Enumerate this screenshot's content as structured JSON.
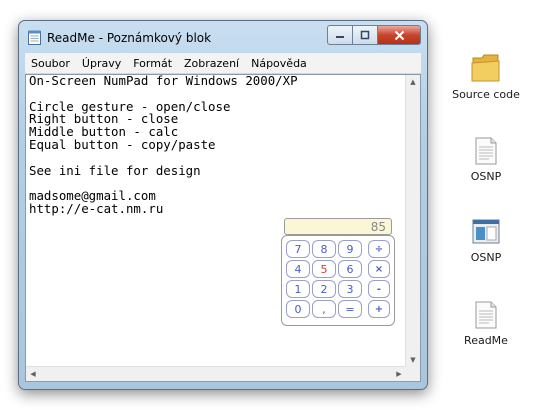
{
  "window": {
    "title": "ReadMe - Poznámkový blok"
  },
  "menu": [
    "Soubor",
    "Úpravy",
    "Formát",
    "Zobrazení",
    "Nápověda"
  ],
  "editor": {
    "lines": [
      "On-Screen NumPad for Windows 2000/XP",
      "",
      "Circle gesture - open/close",
      "Right button - close",
      "Middle button - calc",
      "Equal button - copy/paste",
      "",
      "See ini file for design",
      "",
      "madsome@gmail.com",
      "http://e-cat.nm.ru"
    ]
  },
  "numpad": {
    "display": "85",
    "rows": [
      [
        "7",
        "8",
        "9"
      ],
      [
        "4",
        "5",
        "6"
      ],
      [
        "1",
        "2",
        "3"
      ],
      [
        "0",
        ",",
        "="
      ]
    ],
    "ops": [
      "÷",
      "×",
      "-",
      "+"
    ],
    "highlight_key": "5"
  },
  "desktop": {
    "icons": [
      {
        "label": "Source code",
        "icon": "folder-icon"
      },
      {
        "label": "OSNP",
        "icon": "text-file-icon"
      },
      {
        "label": "OSNP",
        "icon": "application-icon"
      },
      {
        "label": "ReadMe",
        "icon": "text-file-icon"
      }
    ]
  },
  "colors": {
    "close_button": "#c8452d",
    "numpad_key_text": "#4a5cc8",
    "numpad_highlight": "#d0403a",
    "display_bg": "#fbf7d6"
  }
}
